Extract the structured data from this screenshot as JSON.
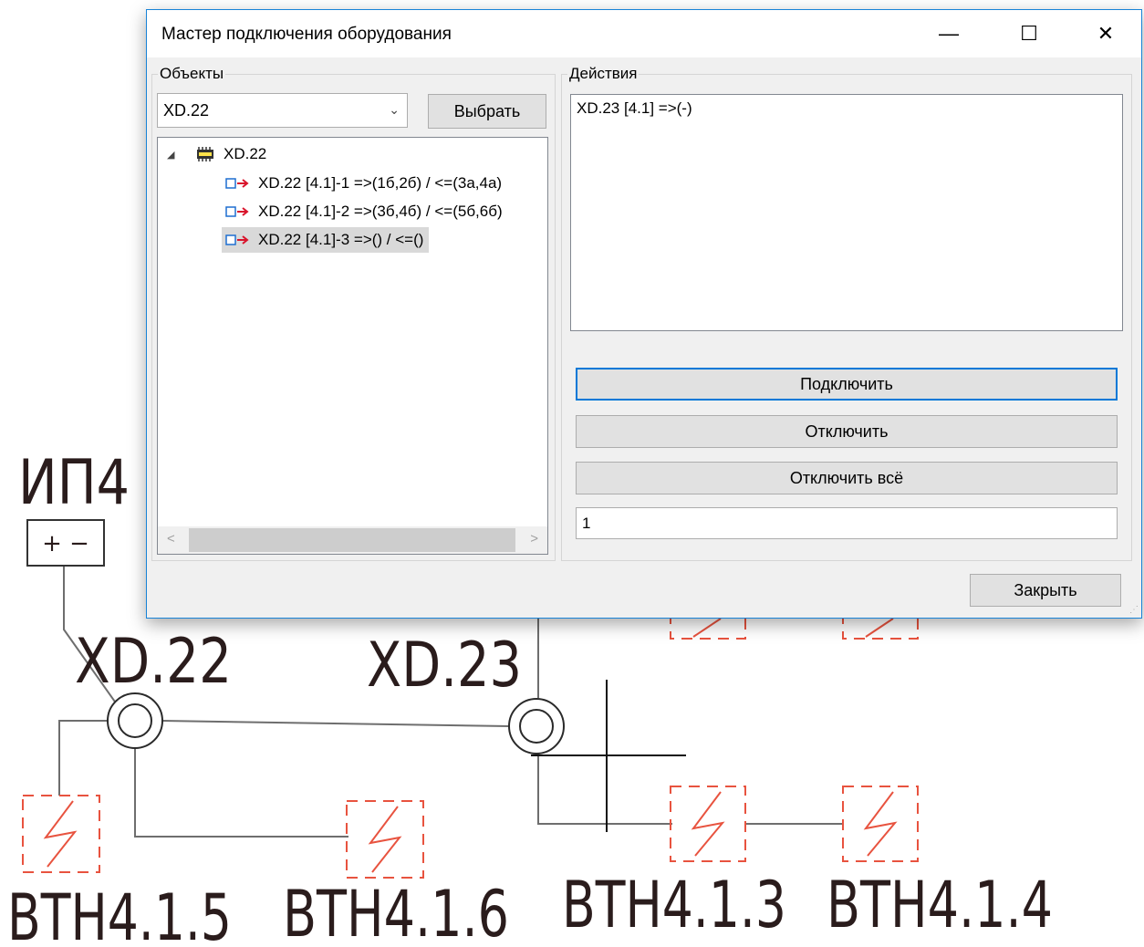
{
  "window": {
    "title": "Мастер подключения оборудования",
    "minimize_glyph": "—",
    "maximize_glyph": "☐",
    "close_glyph": "✕"
  },
  "objects_group": {
    "label": "Объекты",
    "combo_value": "XD.22",
    "select_button": "Выбрать",
    "tree": {
      "root": "XD.22",
      "children": [
        "XD.22 [4.1]-1 =>(1б,2б) / <=(3а,4а)",
        "XD.22 [4.1]-2 =>(3б,4б) / <=(5б,6б)",
        "XD.22 [4.1]-3 =>() / <=()"
      ],
      "selected_index": 2
    }
  },
  "actions_group": {
    "label": "Действия",
    "lines": [
      "XD.23 [4.1] =>(-)"
    ],
    "connect_button": "Подключить",
    "disconnect_button": "Отключить",
    "disconnect_all_button": "Отключить всё",
    "field_value": "1"
  },
  "close_button": "Закрыть",
  "drawing": {
    "labels": {
      "power_source": "ИП4",
      "power_source_terminals": "+ −",
      "connector_1": "XD.22",
      "connector_2": "XD.23",
      "device_1": "ВТН4.1.5",
      "device_2": "ВТН4.1.6",
      "device_3": "ВТН4.1.3",
      "device_4": "ВТН4.1.4"
    },
    "colors": {
      "text": "#2a1c1c",
      "wire": "#6e6e6e",
      "device_outline": "#e8533f",
      "accent": "#0078d7"
    }
  }
}
